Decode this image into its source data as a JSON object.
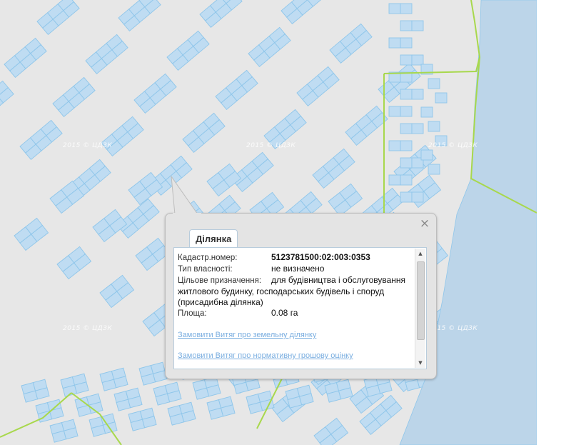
{
  "watermark": "2015 © ЦДЗК",
  "popup": {
    "tab_label": "Ділянка",
    "close_symbol": "×",
    "fields": [
      {
        "label": "Кадастр.номер:",
        "value": "5123781500:02:003:0353"
      },
      {
        "label": "Тип власності:",
        "value": "не визначено"
      },
      {
        "label": "Цільове призначення:",
        "value_line1": "для будівництва і обслуговування",
        "value_rest": "житлового будинку, господарських будівель і споруд (присадибна ділянка)"
      },
      {
        "label": "Площа:",
        "value": "0.08 га"
      }
    ],
    "links": [
      "Замовити Витяг про земельну ділянку",
      "Замовити Витяг про нормативну грошову оцінку"
    ]
  },
  "colors": {
    "map_background": "#e7e7e7",
    "parcel_fill": "#bfdcf2",
    "parcel_stroke": "#8fc6ea",
    "boundary": "#a8d84c",
    "water": "#bcd5e9",
    "link": "#7aaee0"
  },
  "icons": {
    "close": "close-icon",
    "scroll_up": "arrow-up-icon",
    "scroll_down": "arrow-down-icon"
  }
}
